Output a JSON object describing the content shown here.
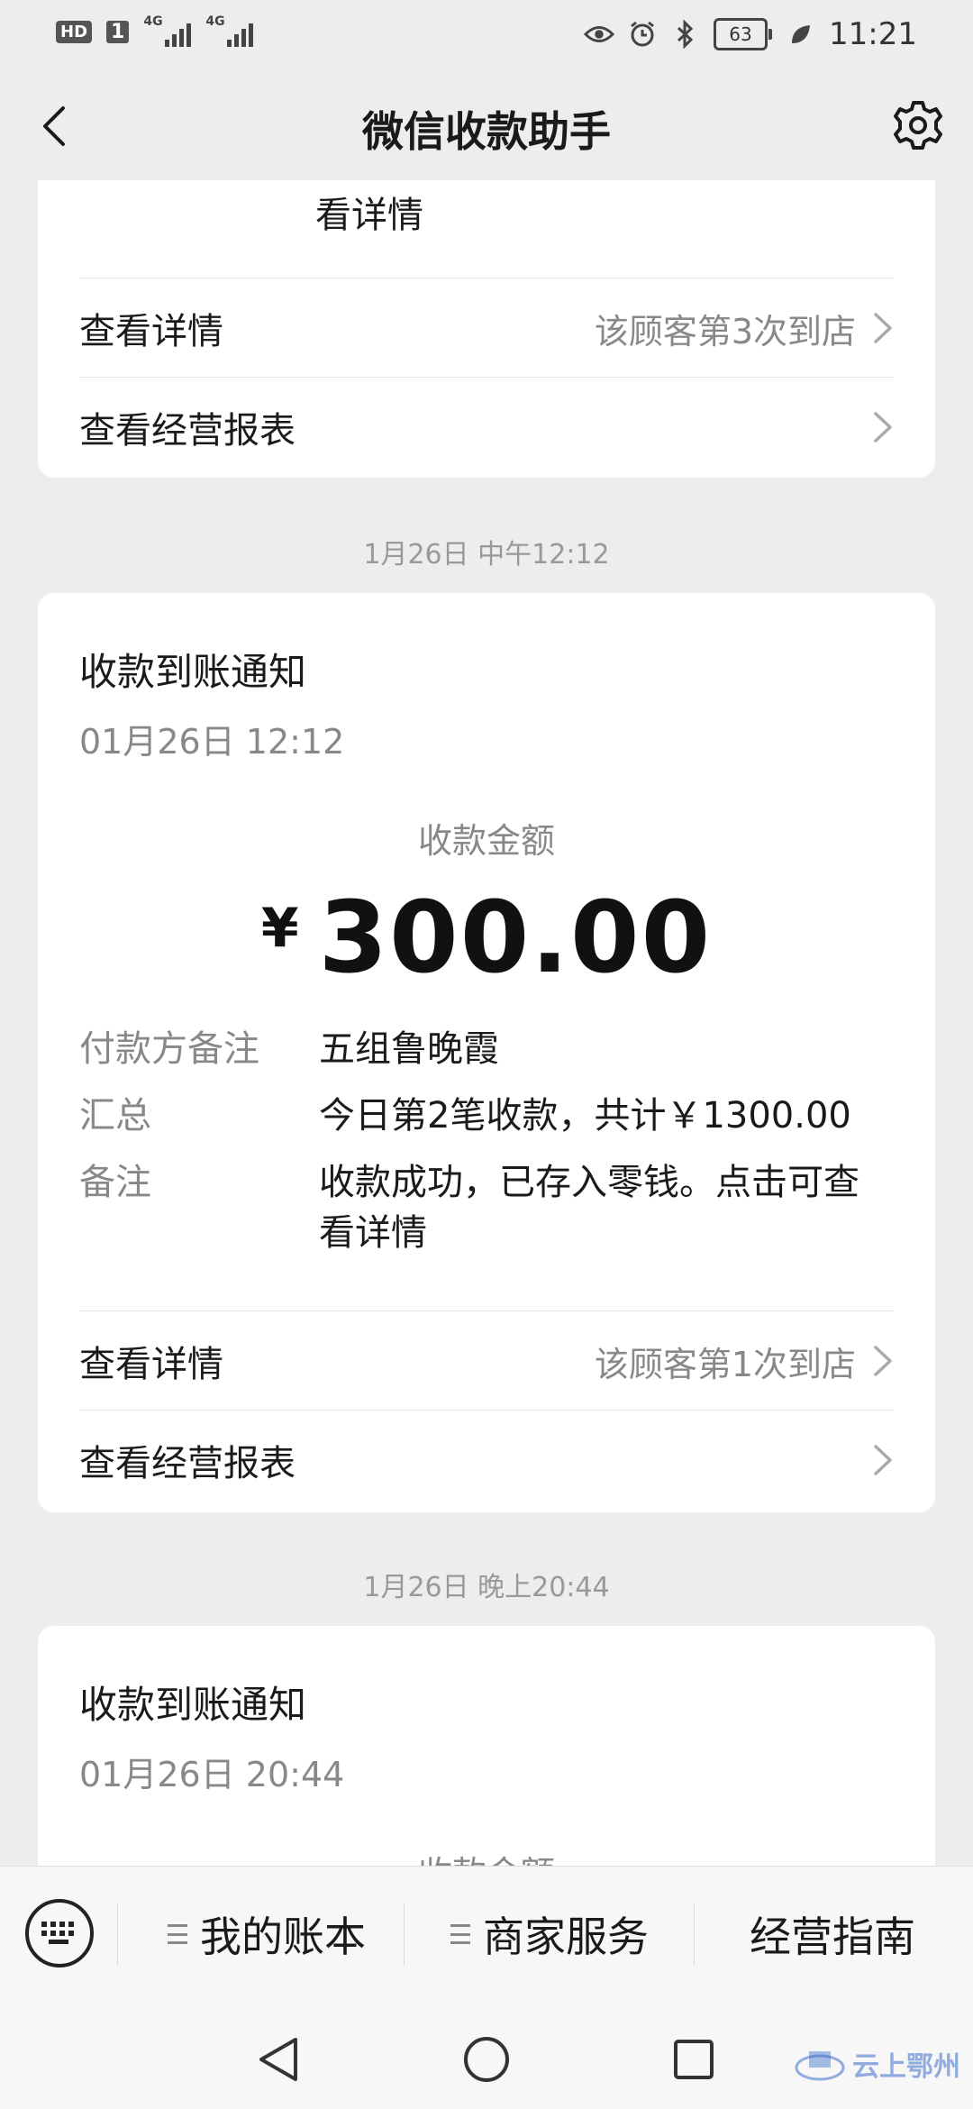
{
  "status_bar": {
    "hd": "HD",
    "sim": "1",
    "net1": "4G",
    "net2": "4G",
    "battery": "63",
    "time": "11:21"
  },
  "header": {
    "title": "微信收款助手"
  },
  "card_partial": {
    "remark_tail": "看详情",
    "details_label": "查看详情",
    "visit_text": "该顾客第3次到店",
    "report_label": "查看经营报表"
  },
  "timestamp1": "1月26日 中午12:12",
  "card_main": {
    "title": "收款到账通知",
    "time": "01月26日 12:12",
    "amount_label": "收款金额",
    "currency": "¥",
    "amount": "300.00",
    "rows": [
      {
        "label": "付款方备注",
        "value": "五组鲁晚霞"
      },
      {
        "label": "汇总",
        "value": "今日第2笔收款，共计￥1300.00"
      },
      {
        "label": "备注",
        "value": "收款成功，已存入零钱。点击可查看详情"
      }
    ],
    "details_label": "查看详情",
    "visit_text": "该顾客第1次到店",
    "report_label": "查看经营报表"
  },
  "timestamp2": "1月26日 晚上20:44",
  "card_last": {
    "title": "收款到账通知",
    "time": "01月26日 20:44",
    "amount_label": "收款金额"
  },
  "menu": {
    "items": [
      "我的账本",
      "商家服务",
      "经营指南"
    ]
  },
  "watermark": "云上鄂州"
}
